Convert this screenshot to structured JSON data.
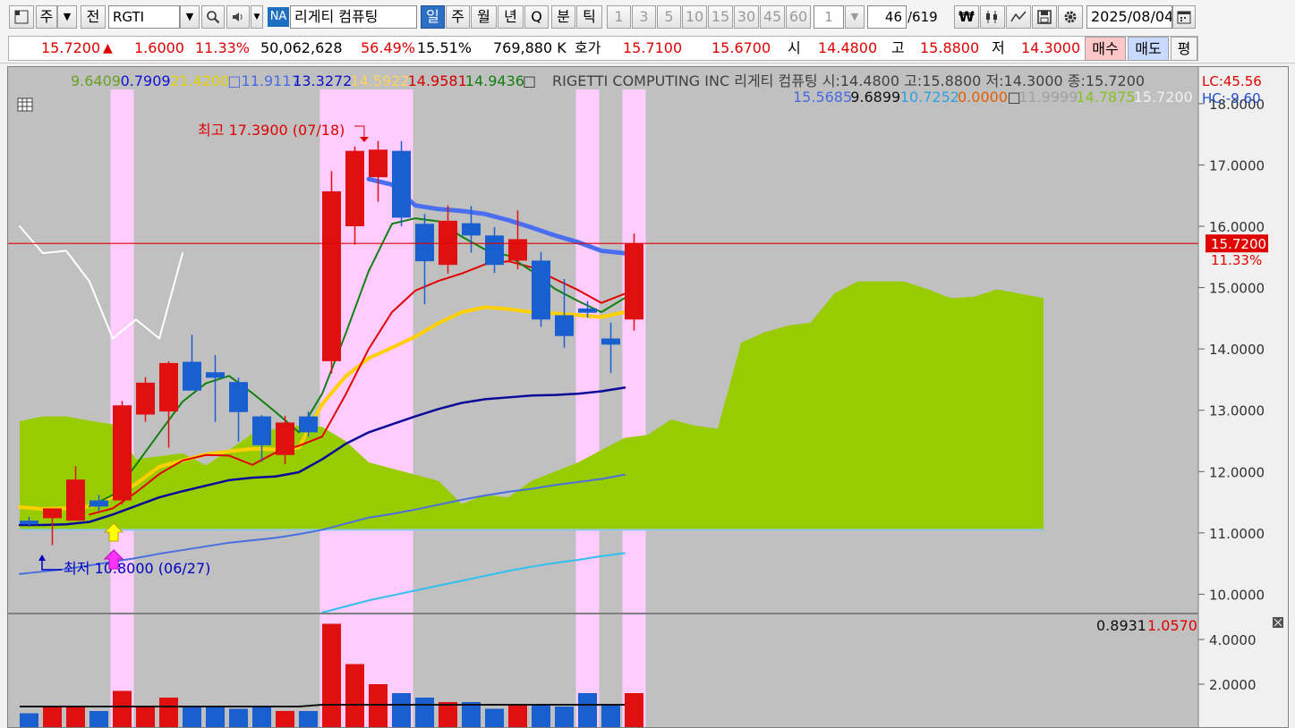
{
  "toolbar": {
    "type_label": "주",
    "prev_label": "전",
    "symbol": "RGTI",
    "na_badge": "NA",
    "stock_name": "리게티 컴퓨팅",
    "periods": [
      "일",
      "주",
      "월",
      "년",
      "Q",
      "분",
      "틱"
    ],
    "active_period": "일",
    "intervals": [
      "1",
      "3",
      "5",
      "10",
      "15",
      "30",
      "45",
      "60"
    ],
    "interval_value": "1",
    "count_value": "46",
    "count_total": "/619",
    "won_symbol": "₩",
    "date": "2025/08/04"
  },
  "quote": {
    "price": "15.7200",
    "change_arrow": "▲",
    "change": "1.6000",
    "change_pct": "11.33%",
    "volume": "50,062,628",
    "vol_ratio": "56.49%",
    "turnover": "15.51%",
    "amount": "769,880 K",
    "hoga_label": "호가",
    "bid": "15.7100",
    "ask": "15.6700",
    "open_label": "시",
    "open": "14.4800",
    "high_label": "고",
    "high": "15.8800",
    "low_label": "저",
    "low": "14.3000",
    "buy_label": "매수",
    "sell_label": "매도",
    "avg_label": "평"
  },
  "chart_header": {
    "line1_values": [
      {
        "text": "9.6409",
        "color": "#6aa020"
      },
      {
        "text": "0.7909",
        "color": "#1010d0"
      },
      {
        "text": "21.4200",
        "color": "#e0d000"
      },
      {
        "text": "□11.9117",
        "color": "#4a6ae0"
      },
      {
        "text": "13.3272",
        "color": "#1010c0"
      },
      {
        "text": "14.5922",
        "color": "#ffd060"
      },
      {
        "text": "14.9581",
        "color": "#d00000"
      },
      {
        "text": "14.9436",
        "color": "#108010"
      },
      {
        "text": "□",
        "color": "#303030"
      }
    ],
    "title": "RIGETTI COMPUTING INC  리게티 컴퓨팅 시:14.4800 고:15.8800 저:14.3000 종:15.7200",
    "line2_values": [
      {
        "text": "15.5685",
        "color": "#4a6ae0"
      },
      {
        "text": "9.6899",
        "color": "#101010"
      },
      {
        "text": "10.7252",
        "color": "#30a0e0"
      },
      {
        "text": "0.0000",
        "color": "#e06000"
      },
      {
        "text": "□",
        "color": "#303030"
      },
      {
        "text": "11.9999",
        "color": "#a0a0a0"
      },
      {
        "text": "14.7875",
        "color": "#88c020"
      },
      {
        "text": "15.7200",
        "color": "#f0f0f0"
      }
    ],
    "lc": "LC:45.56",
    "hc": "HC:-9.60"
  },
  "annotations": {
    "high_note": "최고 17.3900 (07/18)",
    "low_note": "최저 10.8000 (06/27)",
    "price_tag": "15.7200",
    "pct_tag": "11.33%"
  },
  "volume_header": {
    "v1": "0.8931",
    "v2": "1.0570"
  },
  "colors": {
    "up": "#e01010",
    "down": "#1a5fd0",
    "cloud": "#99cc00",
    "highlight": "#ffccff"
  },
  "chart_data": {
    "type": "candlestick",
    "y_axis_labels": [
      "18.0000",
      "17.0000",
      "16.0000",
      "15.0000",
      "14.0000",
      "13.0000",
      "12.0000",
      "11.0000",
      "10.0000"
    ],
    "y_range": [
      9.7,
      18.1
    ],
    "volume_axis_labels": [
      "4.0000",
      "2.0000"
    ],
    "volume_range": [
      0,
      4.6
    ],
    "candles": [
      {
        "o": 11.2,
        "h": 11.26,
        "l": 11.1,
        "c": 11.14
      },
      {
        "o": 11.24,
        "h": 11.34,
        "l": 10.8,
        "c": 11.4
      },
      {
        "o": 11.2,
        "h": 12.09,
        "l": 11.2,
        "c": 11.87
      },
      {
        "o": 11.53,
        "h": 11.62,
        "l": 11.36,
        "c": 11.43
      },
      {
        "o": 11.53,
        "h": 13.15,
        "l": 11.46,
        "c": 13.08
      },
      {
        "o": 12.93,
        "h": 13.54,
        "l": 12.81,
        "c": 13.45
      },
      {
        "o": 12.98,
        "h": 13.8,
        "l": 12.39,
        "c": 13.77
      },
      {
        "o": 13.79,
        "h": 14.23,
        "l": 13.48,
        "c": 13.32
      },
      {
        "o": 13.62,
        "h": 13.9,
        "l": 12.81,
        "c": 13.53
      },
      {
        "o": 13.46,
        "h": 13.53,
        "l": 12.49,
        "c": 12.97
      },
      {
        "o": 12.9,
        "h": 12.92,
        "l": 12.16,
        "c": 12.43
      },
      {
        "o": 12.27,
        "h": 12.91,
        "l": 12.12,
        "c": 12.8
      },
      {
        "o": 12.9,
        "h": 12.98,
        "l": 12.57,
        "c": 12.64
      },
      {
        "o": 13.8,
        "h": 16.9,
        "l": 13.6,
        "c": 16.57
      },
      {
        "o": 16.0,
        "h": 17.3,
        "l": 15.7,
        "c": 17.23
      },
      {
        "o": 16.8,
        "h": 17.39,
        "l": 16.4,
        "c": 17.25
      },
      {
        "o": 17.23,
        "h": 17.39,
        "l": 16.0,
        "c": 16.14
      },
      {
        "o": 16.04,
        "h": 16.2,
        "l": 14.73,
        "c": 15.43
      },
      {
        "o": 15.37,
        "h": 16.34,
        "l": 15.23,
        "c": 16.09
      },
      {
        "o": 16.05,
        "h": 16.33,
        "l": 15.57,
        "c": 15.85
      },
      {
        "o": 15.85,
        "h": 15.99,
        "l": 15.24,
        "c": 15.37
      },
      {
        "o": 15.44,
        "h": 16.26,
        "l": 15.3,
        "c": 15.79
      },
      {
        "o": 15.44,
        "h": 15.58,
        "l": 14.36,
        "c": 14.48
      },
      {
        "o": 14.55,
        "h": 15.14,
        "l": 14.02,
        "c": 14.21
      },
      {
        "o": 14.66,
        "h": 14.78,
        "l": 14.51,
        "c": 14.59
      },
      {
        "o": 14.17,
        "h": 14.43,
        "l": 13.61,
        "c": 14.07
      },
      {
        "o": 14.48,
        "h": 15.88,
        "l": 14.3,
        "c": 15.72
      }
    ],
    "volumes": [
      0.7,
      1.0,
      1.0,
      0.8,
      1.7,
      1.0,
      1.4,
      1.0,
      1.0,
      0.9,
      1.0,
      0.8,
      0.8,
      4.7,
      2.9,
      2.0,
      1.6,
      1.4,
      1.2,
      1.2,
      0.9,
      1.1,
      1.1,
      1.0,
      1.6,
      1.1,
      1.6
    ],
    "highlight_candles": [
      4,
      13,
      14,
      15,
      16,
      24,
      26
    ],
    "ma_green": [
      null,
      null,
      null,
      11.43,
      11.62,
      12.11,
      12.63,
      13.14,
      13.44,
      13.56,
      13.28,
      12.97,
      12.64,
      13.27,
      14.24,
      15.27,
      16.04,
      16.13,
      16.08,
      15.83,
      15.62,
      15.52,
      15.27,
      14.98,
      14.78,
      14.6,
      14.83
    ],
    "ma_red": [
      null,
      null,
      null,
      11.3,
      11.4,
      11.66,
      11.96,
      12.18,
      12.27,
      12.26,
      12.11,
      12.31,
      12.42,
      12.57,
      13.25,
      14.0,
      14.6,
      14.95,
      15.11,
      15.23,
      15.38,
      15.43,
      15.33,
      15.14,
      14.96,
      14.75,
      14.9
    ],
    "ma_yellow": [
      11.42,
      11.39,
      11.4,
      11.43,
      11.59,
      11.8,
      12.08,
      12.18,
      12.28,
      12.33,
      12.37,
      12.36,
      12.39,
      13.1,
      13.55,
      13.85,
      14.02,
      14.2,
      14.42,
      14.6,
      14.68,
      14.65,
      14.6,
      14.58,
      14.55,
      14.52,
      14.6
    ],
    "ma_navy": [
      11.13,
      11.13,
      11.14,
      11.18,
      11.3,
      11.44,
      11.58,
      11.68,
      11.77,
      11.86,
      11.9,
      11.92,
      11.99,
      12.2,
      12.45,
      12.64,
      12.77,
      12.9,
      13.02,
      13.12,
      13.18,
      13.21,
      13.24,
      13.25,
      13.27,
      13.31,
      13.37
    ],
    "ma_blue_thick": [
      null,
      null,
      null,
      null,
      null,
      null,
      null,
      null,
      null,
      null,
      null,
      null,
      null,
      null,
      null,
      16.77,
      16.68,
      16.34,
      16.28,
      16.25,
      16.2,
      16.1,
      15.98,
      15.85,
      15.74,
      15.6,
      15.56
    ],
    "line_steel": [
      10.33,
      10.37,
      10.41,
      10.47,
      10.53,
      10.59,
      10.66,
      10.72,
      10.78,
      10.84,
      10.88,
      10.92,
      10.98,
      11.05,
      11.15,
      11.25,
      11.31,
      11.38,
      11.46,
      11.54,
      11.61,
      11.67,
      11.72,
      11.78,
      11.83,
      11.88,
      11.95
    ],
    "line_sky": [
      null,
      null,
      null,
      null,
      null,
      null,
      null,
      null,
      null,
      null,
      null,
      null,
      null,
      9.7,
      9.8,
      9.9,
      9.98,
      10.06,
      10.14,
      10.22,
      10.3,
      10.38,
      10.45,
      10.51,
      10.56,
      10.62,
      10.67
    ],
    "line_white": [
      16.0,
      15.56,
      15.6,
      15.1,
      14.17,
      14.48,
      14.17,
      15.56
    ],
    "cloud_top": [
      12.82,
      12.9,
      12.9,
      12.83,
      12.77,
      12.2,
      12.25,
      12.3,
      12.1,
      12.35,
      12.62,
      12.7,
      12.75,
      12.73,
      12.5,
      12.15,
      12.05,
      11.95,
      11.85,
      11.47,
      11.62,
      11.58,
      11.85,
      12.0,
      12.15,
      12.35,
      12.55,
      12.6,
      12.85,
      12.75,
      12.7,
      14.1,
      14.27,
      14.38,
      14.43,
      14.9,
      15.1,
      15.1,
      15.1,
      14.98,
      14.83,
      14.85,
      14.97,
      14.9,
      14.83
    ],
    "cloud_base": 11.05,
    "current_price": 15.72
  }
}
